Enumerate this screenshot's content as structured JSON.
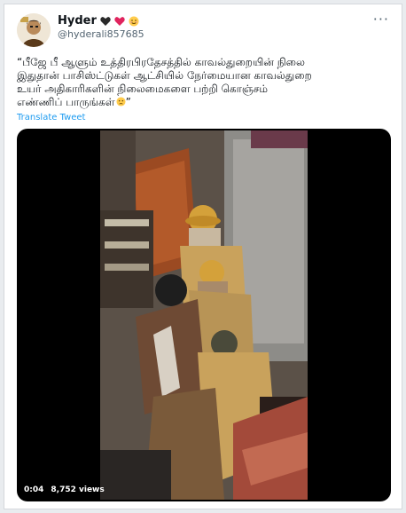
{
  "author": {
    "name": "Hyder",
    "handle": "@hyderali857685",
    "name_emojis": [
      "black-heart-icon",
      "red-heart-icon",
      "smiling-face-icon"
    ]
  },
  "menu": {
    "more_label": "···"
  },
  "tweet": {
    "text_line1": "“பீஜே பீ ஆளும் உத்திரபிரதேசத்தில் காவல்துறையின் நிலை",
    "text_line2": "இதுதான் பாசிஸ்ட்டுகள் ஆட்சியில் நேர்மையான காவல்துறை",
    "text_line3": "உயர் அதிகாரிகளின் நிலைமைகளை பற்றி கொஞ்சம்",
    "text_line4": "எண்ணிப் பாருங்கள்",
    "text_end_emoji": "worried-face-icon",
    "text_close_quote": "”",
    "translate_label": "Translate Tweet"
  },
  "media": {
    "type": "video",
    "duration": "0:04",
    "views": "8,752 views",
    "colors": {
      "background": "#000000",
      "uniform": "#c9a25c",
      "helmet": "#d4a13a"
    }
  }
}
